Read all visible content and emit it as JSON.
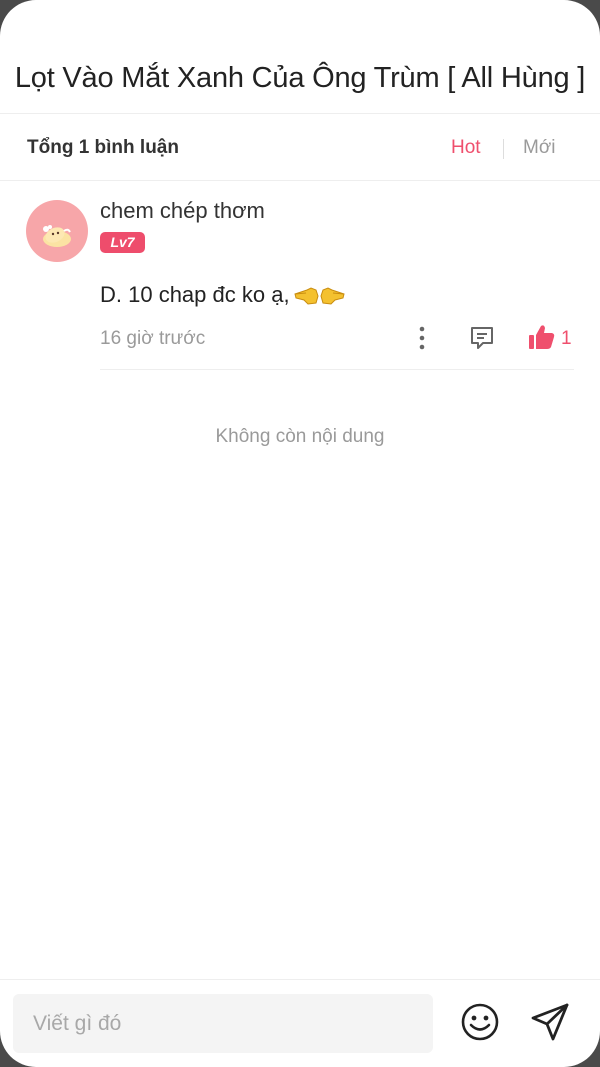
{
  "header": {
    "title": "Lọt Vào Mắt Xanh Của Ông Trùm [ All Hùng ]"
  },
  "comments_bar": {
    "count_label": "Tổng 1 bình luận",
    "sort_hot": "Hot",
    "sort_new": "Mới"
  },
  "comment": {
    "username": "chem chép thơm",
    "level": "Lv7",
    "text": "D. 10 chap đc ko ạ,",
    "time": "16 giờ trước",
    "likes": "1"
  },
  "end_text": "Không còn nội dung",
  "composer": {
    "placeholder": "Viết gì đó"
  },
  "colors": {
    "accent": "#ef4f6d",
    "level_badge": "#ee4d6c",
    "avatar_bg": "#f7a6a9"
  },
  "icons": [
    "avatar-bear",
    "pointing-hand-emoji",
    "more-vertical-icon",
    "reply-icon",
    "thumbs-up-icon",
    "emoji-icon",
    "send-icon"
  ]
}
